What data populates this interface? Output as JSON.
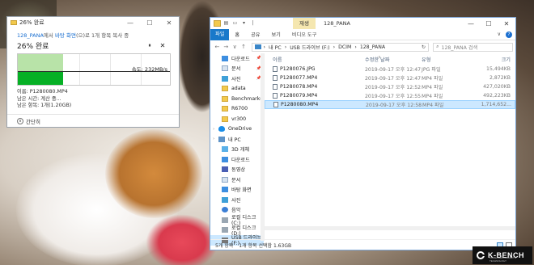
{
  "copy_dialog": {
    "title": "26% 완료",
    "subtitle_prefix": "128_PANA",
    "subtitle_mid": "에서 ",
    "subtitle_link": "바탕 화면",
    "subtitle_suffix": "(으)로 1개 항목 복사 중",
    "percent_label": "26% 완료",
    "pause_glyph": "⏸",
    "close_glyph": "✕",
    "speed": "속도: 232MB/s",
    "progress": 0.26,
    "info": [
      "이름: P1280080.MP4",
      "남은 시간: 계산 중...",
      "남은 항목: 1개(1.20GB)"
    ],
    "less_details": "간단히",
    "controls": [
      "—",
      "☐",
      "✕"
    ]
  },
  "explorer": {
    "context_tab": "재생",
    "window_title": "128_PANA",
    "controls": [
      "—",
      "☐",
      "✕"
    ],
    "ribbon": {
      "file": "파일",
      "tabs": [
        "홈",
        "공유",
        "보기"
      ],
      "tool": "비디오 도구"
    },
    "address": {
      "back": "←",
      "forward": "→",
      "dropdown": "∨",
      "up": "↑",
      "segments": [
        "내 PC",
        "USB 드라이브 (F:)",
        "DCIM",
        "128_PANA"
      ],
      "separator": "›",
      "refresh": "↻",
      "search_placeholder": "128_PANA 검색"
    },
    "nav": [
      {
        "label": "다운로드",
        "icon": "download-icon",
        "pin": true,
        "top": false
      },
      {
        "label": "문서",
        "icon": "document-icon",
        "pin": true,
        "top": false
      },
      {
        "label": "사진",
        "icon": "pictures-icon",
        "pin": true,
        "top": false
      },
      {
        "label": "adata",
        "icon": "folder-icon",
        "pin": false,
        "top": false
      },
      {
        "label": "Benchmarks",
        "icon": "folder-icon",
        "pin": false,
        "top": false
      },
      {
        "label": "R6700",
        "icon": "folder-icon",
        "pin": false,
        "top": false
      },
      {
        "label": "vr300",
        "icon": "folder-icon",
        "pin": false,
        "top": false
      },
      {
        "label": "OneDrive",
        "icon": "cloud-icon",
        "pin": false,
        "top": true
      },
      {
        "label": "내 PC",
        "icon": "pc-icon",
        "pin": false,
        "top": true
      },
      {
        "label": "3D 개체",
        "icon": "cube-icon",
        "pin": false,
        "top": false
      },
      {
        "label": "다운로드",
        "icon": "download-icon",
        "pin": false,
        "top": false
      },
      {
        "label": "동영상",
        "icon": "video-icon",
        "pin": false,
        "top": false
      },
      {
        "label": "문서",
        "icon": "document-icon",
        "pin": false,
        "top": false
      },
      {
        "label": "바탕 화면",
        "icon": "desktop-icon",
        "pin": false,
        "top": false
      },
      {
        "label": "사진",
        "icon": "pictures-icon",
        "pin": false,
        "top": false
      },
      {
        "label": "음악",
        "icon": "music-icon",
        "pin": false,
        "top": false
      },
      {
        "label": "로컬 디스크 (C:)",
        "icon": "disk-icon",
        "pin": false,
        "top": false
      },
      {
        "label": "로컬 디스크 (D:)",
        "icon": "disk-icon",
        "pin": false,
        "top": false
      },
      {
        "label": "USB 드라이브 (F:)",
        "icon": "usb-drive-icon",
        "pin": false,
        "top": false,
        "selected": true
      }
    ],
    "columns": [
      "이름",
      "수정한 날짜",
      "유형",
      "크기"
    ],
    "files": [
      {
        "name": "P1280076.JPG",
        "date": "2019-09-17 오후 12:47",
        "type": "JPG 파일",
        "size": "15,494KB",
        "selected": false
      },
      {
        "name": "P1280077.MP4",
        "date": "2019-09-17 오후 12:47",
        "type": "MP4 파일",
        "size": "2,872KB",
        "selected": false
      },
      {
        "name": "P1280078.MP4",
        "date": "2019-09-17 오후 12:52",
        "type": "MP4 파일",
        "size": "427,020KB",
        "selected": false
      },
      {
        "name": "P1280079.MP4",
        "date": "2019-09-17 오후 12:55",
        "type": "MP4 파일",
        "size": "492,223KB",
        "selected": false
      },
      {
        "name": "P1280080.MP4",
        "date": "2019-09-17 오후 12:58",
        "type": "MP4 파일",
        "size": "1,714,652...",
        "selected": true
      }
    ],
    "status": {
      "count": "5개 항목",
      "selection": "1개 항목 선택함 1.63GB"
    }
  },
  "watermark": {
    "brand": "K-BENCH",
    "tagline": "KOREA BENCHMARK & TECHNOLOGY"
  },
  "colors": {
    "accent": "#1979ca",
    "progress_green": "#06b025",
    "selection": "#cce8ff",
    "context_tab": "#f5e7b0"
  }
}
